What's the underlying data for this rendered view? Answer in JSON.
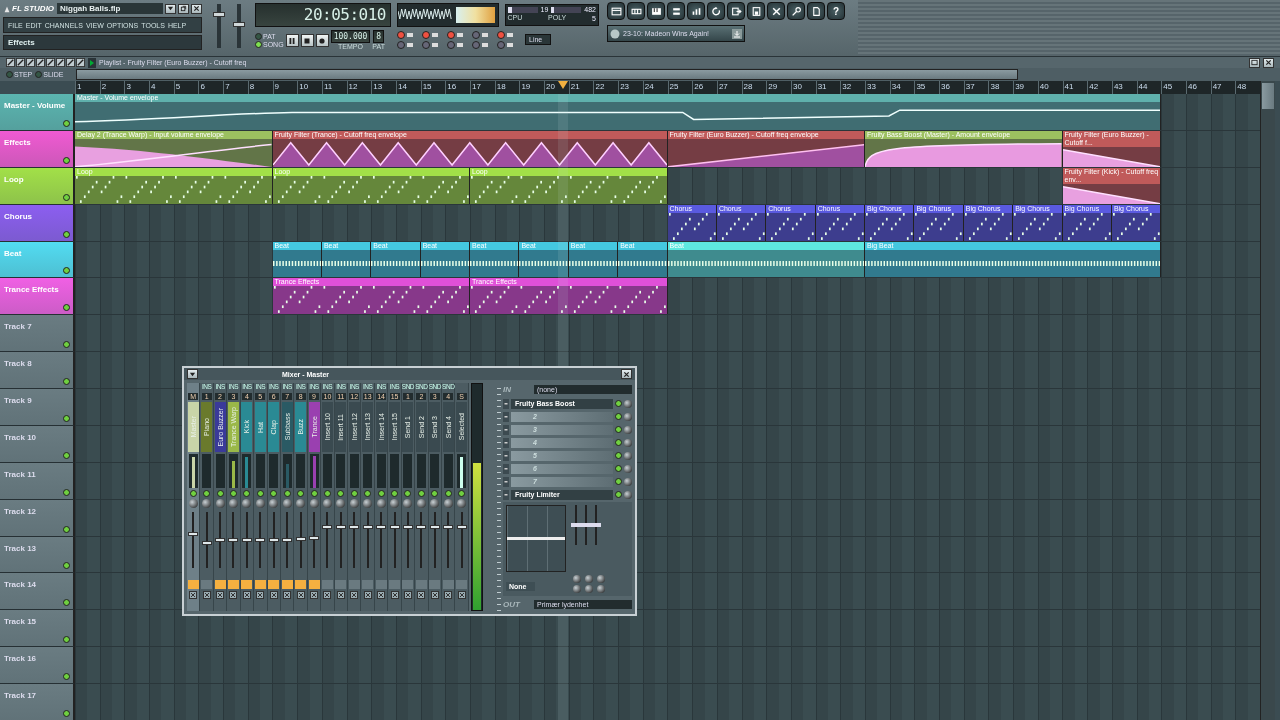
{
  "app": {
    "logo": "FL STUDIO",
    "file_name": "Niggah Balls.flp",
    "menu": [
      "FILE",
      "EDIT",
      "CHANNELS",
      "VIEW",
      "OPTIONS",
      "TOOLS",
      "HELP"
    ],
    "hint": "Effects",
    "help": "?"
  },
  "sliders": [
    {
      "kind": "volume",
      "level": 0.8
    },
    {
      "kind": "pitch",
      "level": 0.55
    }
  ],
  "transport": {
    "time": "20:05:010",
    "modes": [
      {
        "label": "PAT",
        "selected": false
      },
      {
        "label": "SONG",
        "selected": true
      }
    ],
    "tempo": "100.000",
    "tempo_label": "TEMPO",
    "pattern": "8",
    "pattern_label": "PAT"
  },
  "record_options": [
    {
      "on": true
    },
    {
      "on": true
    },
    {
      "on": true
    },
    {
      "on": false
    },
    {
      "on": true
    },
    {
      "on": false
    },
    {
      "on": false
    },
    {
      "on": false
    },
    {
      "on": false
    },
    {
      "on": false
    }
  ],
  "snap": "Line",
  "monitor": {
    "cpu": {
      "reading": "19",
      "level": 0.15
    },
    "poly": {
      "reading": "482",
      "level": 0.1
    },
    "cpu_label": "CPU",
    "poly_label": "POLY",
    "value": "5"
  },
  "browser": {
    "song": "23-10: Madeon Wins Again!"
  },
  "playlist": {
    "title": "Playlist - Fruity Filter (Euro Buzzer) - Cutoff freq",
    "modes": [
      {
        "label": "STEP",
        "selected": false
      },
      {
        "label": "SLIDE",
        "selected": false
      }
    ],
    "ruler": [
      "1",
      "2",
      "3",
      "4",
      "5",
      "6",
      "7",
      "8",
      "9",
      "10",
      "11",
      "12",
      "13",
      "14",
      "15",
      "16",
      "17",
      "18",
      "19",
      "20",
      "21",
      "22",
      "23",
      "24",
      "25",
      "26",
      "27",
      "28",
      "29",
      "30",
      "31",
      "32",
      "33",
      "34",
      "35",
      "36",
      "37",
      "38",
      "39",
      "40",
      "41",
      "42",
      "43",
      "44",
      "45",
      "46",
      "47",
      "48"
    ],
    "tracks": [
      {
        "name": "Master - Volume",
        "color": "#5bb5b0",
        "clips": [
          {
            "label": "Master - Volume envelope",
            "kind": "envelope",
            "color": "#5fb0ac"
          }
        ]
      },
      {
        "name": "Effects",
        "color": "#f05ad2",
        "clips": [
          {
            "label": "Delay 2 (Trance Warp) - Input volume envelope",
            "kind": "envelope",
            "color": "#9cc060"
          },
          {
            "label": "Fruity Filter (Trance) - Cutoff freq envelope",
            "kind": "envelope",
            "color": "#c05a5a"
          },
          {
            "label": "Fruity Filter (Euro Buzzer) - Cutoff freq envelope",
            "kind": "envelope",
            "color": "#c05a5a"
          },
          {
            "label": "Fruity Bass Boost (Master) - Amount envelope",
            "kind": "envelope",
            "color": "#9cc060"
          },
          {
            "label": "Fruity Filter (Euro Buzzer) - Cutoff f...",
            "kind": "envelope",
            "color": "#c05a5a"
          }
        ]
      },
      {
        "name": "Loop",
        "color": "#a2e048",
        "clips": [
          {
            "label": "Loop",
            "kind": "pattern",
            "color": "#a2e048"
          },
          {
            "label": "Loop",
            "kind": "pattern",
            "color": "#a2e048"
          },
          {
            "label": "Loop",
            "kind": "pattern",
            "color": "#a2e048"
          },
          {
            "label": "Fruity Filter (Kick) - Cutoff freq env...",
            "kind": "envelope",
            "color": "#c05a5a"
          }
        ]
      },
      {
        "name": "Chorus",
        "color": "#8c5ef0",
        "clips": [
          {
            "label": "Chorus",
            "kind": "pattern",
            "color": "#5a5ae0"
          },
          {
            "label": "Chorus",
            "kind": "pattern",
            "color": "#5a5ae0"
          },
          {
            "label": "Chorus",
            "kind": "pattern",
            "color": "#5a5ae0"
          },
          {
            "label": "Chorus",
            "kind": "pattern",
            "color": "#5a5ae0"
          },
          {
            "label": "Big Chorus",
            "kind": "pattern",
            "color": "#5a5ae0"
          },
          {
            "label": "Big Chorus",
            "kind": "pattern",
            "color": "#5a5ae0"
          },
          {
            "label": "Big Chorus",
            "kind": "pattern",
            "color": "#5a5ae0"
          },
          {
            "label": "Big Chorus",
            "kind": "pattern",
            "color": "#5a5ae0"
          },
          {
            "label": "Big Chorus",
            "kind": "pattern",
            "color": "#5a5ae0"
          },
          {
            "label": "Big Chorus",
            "kind": "pattern",
            "color": "#5a5ae0"
          }
        ]
      },
      {
        "name": "Beat",
        "color": "#52dcf2",
        "clips": [
          {
            "label": "Beat",
            "kind": "beat",
            "color": "#44c8e0"
          },
          {
            "label": "Beat",
            "kind": "beat",
            "color": "#44c8e0"
          },
          {
            "label": "Beat",
            "kind": "beat",
            "color": "#44c8e0"
          },
          {
            "label": "Beat",
            "kind": "beat",
            "color": "#44c8e0"
          },
          {
            "label": "Beat",
            "kind": "beat",
            "color": "#44c8e0"
          },
          {
            "label": "Beat",
            "kind": "beat",
            "color": "#44c8e0"
          },
          {
            "label": "Beat",
            "kind": "beat",
            "color": "#44c8e0"
          },
          {
            "label": "Beat",
            "kind": "beat",
            "color": "#44c8e0"
          },
          {
            "label": "Beat",
            "kind": "beat",
            "color": "#5ee8e0"
          },
          {
            "label": "Big Beat",
            "kind": "beat",
            "color": "#44c8e0"
          }
        ]
      },
      {
        "name": "Trance Effects",
        "color": "#f060e4",
        "clips": [
          {
            "label": "Trance Effects",
            "kind": "pattern",
            "color": "#e050d8"
          },
          {
            "label": "Trance Effects",
            "kind": "pattern",
            "color": "#e050d8"
          }
        ]
      },
      {
        "name": "Track 7",
        "color": "#6a7c82"
      },
      {
        "name": "Track 8",
        "color": "#6a7c82"
      },
      {
        "name": "Track 9",
        "color": "#6a7c82"
      },
      {
        "name": "Track 10",
        "color": "#6a7c82"
      },
      {
        "name": "Track 11",
        "color": "#6a7c82"
      },
      {
        "name": "Track 12",
        "color": "#6a7c82"
      },
      {
        "name": "Track 13",
        "color": "#6a7c82"
      },
      {
        "name": "Track 14",
        "color": "#6a7c82"
      },
      {
        "name": "Track 15",
        "color": "#6a7c82"
      },
      {
        "name": "Track 16",
        "color": "#6a7c82"
      },
      {
        "name": "Track 17",
        "color": "#6a7c82"
      }
    ]
  },
  "mixer": {
    "title": "Mixer - Master",
    "strips": [
      {
        "number": "M",
        "name": "Master",
        "color": "#c8d4a8",
        "level": 0.62,
        "meter": {
          "level": 0.9
        },
        "selected": true,
        "routed": true
      },
      {
        "tag": "INS",
        "number": "1",
        "name": "Piano",
        "color": "#6a7a2c",
        "level": 0.45,
        "meter": {
          "level": 0
        },
        "selected": false,
        "routed": false
      },
      {
        "tag": "INS",
        "number": "2",
        "name": "Euro Buzzer",
        "color": "#3a3a9a",
        "level": 0.5,
        "meter": {
          "level": 0
        },
        "selected": false,
        "routed": true
      },
      {
        "tag": "INS",
        "number": "3",
        "name": "Trance Warp",
        "color": "#9ab848",
        "level": 0.5,
        "meter": {
          "level": 0.8
        },
        "selected": false,
        "routed": true
      },
      {
        "tag": "INS",
        "number": "4",
        "name": "Kick",
        "color": "#2a8a94",
        "level": 0.5,
        "meter": {
          "level": 0.9
        },
        "selected": false,
        "routed": true
      },
      {
        "tag": "INS",
        "number": "5",
        "name": "Hat",
        "color": "#2a8a94",
        "level": 0.5,
        "meter": {
          "level": 0
        },
        "selected": false,
        "routed": true
      },
      {
        "tag": "INS",
        "number": "6",
        "name": "Clap",
        "color": "#2a8a94",
        "level": 0.5,
        "meter": {
          "level": 0
        },
        "selected": false,
        "routed": true
      },
      {
        "tag": "INS",
        "number": "7",
        "name": "Subbass",
        "color": "#2a5a64",
        "level": 0.5,
        "meter": {
          "level": 0.7
        },
        "selected": false,
        "routed": true
      },
      {
        "tag": "INS",
        "number": "8",
        "name": "Buzz",
        "color": "#2a8a94",
        "level": 0.52,
        "meter": {
          "level": 0
        },
        "selected": false,
        "routed": true
      },
      {
        "tag": "INS",
        "number": "9",
        "name": "Trance",
        "color": "#9a40b0",
        "level": 0.53,
        "meter": {
          "level": 0.95
        },
        "selected": false,
        "routed": true
      },
      {
        "tag": "INS",
        "number": "10",
        "name": "Insert 10",
        "color": "#3a4a50",
        "level": 0.75,
        "meter": {
          "level": 0
        },
        "selected": false,
        "routed": false
      },
      {
        "tag": "INS",
        "number": "11",
        "name": "Insert 11",
        "color": "#3a4a50",
        "level": 0.75,
        "meter": {
          "level": 0
        },
        "selected": false,
        "routed": false
      },
      {
        "tag": "INS",
        "number": "12",
        "name": "Insert 12",
        "color": "#3a4a50",
        "level": 0.75,
        "meter": {
          "level": 0
        },
        "selected": false,
        "routed": false
      },
      {
        "tag": "INS",
        "number": "13",
        "name": "Insert 13",
        "color": "#3a4a50",
        "level": 0.75,
        "meter": {
          "level": 0
        },
        "selected": false,
        "routed": false
      },
      {
        "tag": "INS",
        "number": "14",
        "name": "Insert 14",
        "color": "#3a4a50",
        "level": 0.75,
        "meter": {
          "level": 0
        },
        "selected": false,
        "routed": false
      },
      {
        "tag": "INS",
        "number": "15",
        "name": "Insert 15",
        "color": "#3a4a50",
        "level": 0.75,
        "meter": {
          "level": 0
        },
        "selected": false,
        "routed": false
      },
      {
        "tag": "SND",
        "number": "1",
        "name": "Send 1",
        "color": "#3a4a50",
        "level": 0.75,
        "meter": {
          "level": 0
        },
        "selected": false,
        "routed": false
      },
      {
        "tag": "SND",
        "number": "2",
        "name": "Send 2",
        "color": "#3a4a50",
        "level": 0.75,
        "meter": {
          "level": 0
        },
        "selected": false,
        "routed": false
      },
      {
        "tag": "SND",
        "number": "3",
        "name": "Send 3",
        "color": "#3a4a50",
        "level": 0.75,
        "meter": {
          "level": 0
        },
        "selected": false,
        "routed": false
      },
      {
        "tag": "SND",
        "number": "4",
        "name": "Send 4",
        "color": "#3a4a50",
        "level": 0.75,
        "meter": {
          "level": 0
        },
        "selected": false,
        "routed": false
      },
      {
        "number": "S",
        "name": "Selected",
        "color": "#3a4a50",
        "level": 0.75,
        "meter": {
          "level": 0.9
        },
        "selected": false,
        "routed": false
      }
    ],
    "master_meter": {
      "level": 0.65
    },
    "in_label": "IN",
    "input": "(none)",
    "slots": [
      {
        "name": "Fruity Bass Boost",
        "kind": "plugin"
      },
      {
        "name": "2",
        "kind": "empty"
      },
      {
        "name": "3",
        "kind": "empty"
      },
      {
        "name": "4",
        "kind": "empty"
      },
      {
        "name": "5",
        "kind": "empty"
      },
      {
        "name": "6",
        "kind": "empty"
      },
      {
        "name": "7",
        "kind": "empty"
      },
      {
        "name": "Fruity Limiter",
        "kind": "plugin"
      }
    ],
    "preset": "None",
    "out_label": "OUT",
    "output": "Primær lydenhet"
  }
}
